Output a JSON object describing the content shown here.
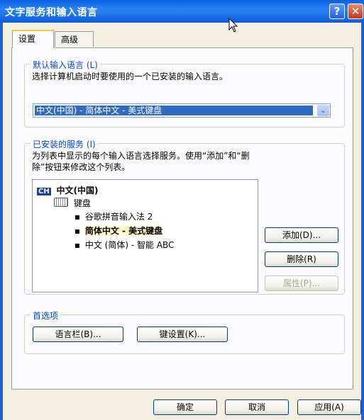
{
  "window": {
    "title": "文字服务和输入语言",
    "help_glyph": "?",
    "close_glyph": "✕"
  },
  "tabs": [
    {
      "label": "设置"
    },
    {
      "label": "高级"
    }
  ],
  "default_language": {
    "legend": "默认输入语言 (L)",
    "description": "选择计算机启动时要使用的一个已安装的输入语言。",
    "selected_value": "中文(中国) - 简体中文 - 美式键盘",
    "arrow": "⌄"
  },
  "installed_services": {
    "legend": "已安装的服务 (I)",
    "description_line1": "为列表中显示的每个输入语言选择服务。使用“添加”和“删",
    "description_line2": "除”按钮来修改这个列表。",
    "tree": {
      "language_badge": "CH",
      "language": "中文(中国)",
      "category": "键盘",
      "bullet": "▪",
      "items": [
        {
          "label": "谷歌拼音输入法 2",
          "selected": false
        },
        {
          "label": "简体中文 - 美式键盘",
          "selected": true
        },
        {
          "label": "中文 (简体) - 智能 ABC",
          "selected": false
        }
      ]
    },
    "buttons": {
      "add": "添加(D)...",
      "remove": "删除(R)",
      "properties": "属性(P)..."
    }
  },
  "preferences": {
    "legend": "首选项",
    "language_bar": "语言栏(B)...",
    "key_settings": "键设置(K)..."
  },
  "footer": {
    "ok": "确定",
    "cancel": "取消",
    "apply": "应用(A)"
  },
  "colors": {
    "titlebar": "#0a5fe0",
    "legend_text": "#0046d5",
    "selection": "#316ac5",
    "selected_item_bg": "#fff8c8"
  }
}
